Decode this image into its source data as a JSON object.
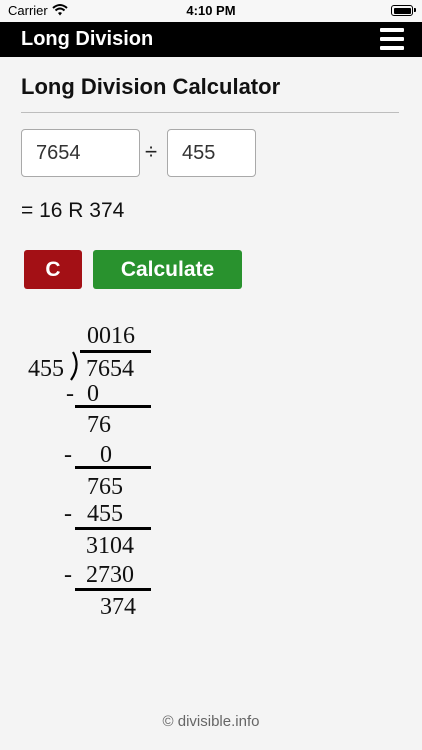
{
  "status_bar": {
    "carrier": "Carrier",
    "time": "4:10 PM",
    "battery_level": 1.0
  },
  "header": {
    "title": "Long Division",
    "menu_icon": "hamburger-menu-icon"
  },
  "page_title": "Long Division Calculator",
  "inputs": {
    "dividend": "7654",
    "divide_symbol": "÷",
    "divisor": "455"
  },
  "result": "= 16 R 374",
  "buttons": {
    "clear": "C",
    "calculate": "Calculate"
  },
  "work": {
    "quotient": "0016",
    "divisor": "455",
    "dividend": "7654",
    "steps": [
      {
        "minus": "-",
        "subtract": "0",
        "remainder": "76"
      },
      {
        "minus": "-",
        "subtract": "0",
        "remainder": "765"
      },
      {
        "minus": "-",
        "subtract": "455",
        "remainder": "3104"
      },
      {
        "minus": "-",
        "subtract": "2730",
        "remainder": "374"
      }
    ]
  },
  "footer": "© divisible.info",
  "colors": {
    "header_bg": "#000000",
    "clear_button": "#a31015",
    "calculate_button": "#29922e",
    "page_bg": "#f4f4f4"
  }
}
